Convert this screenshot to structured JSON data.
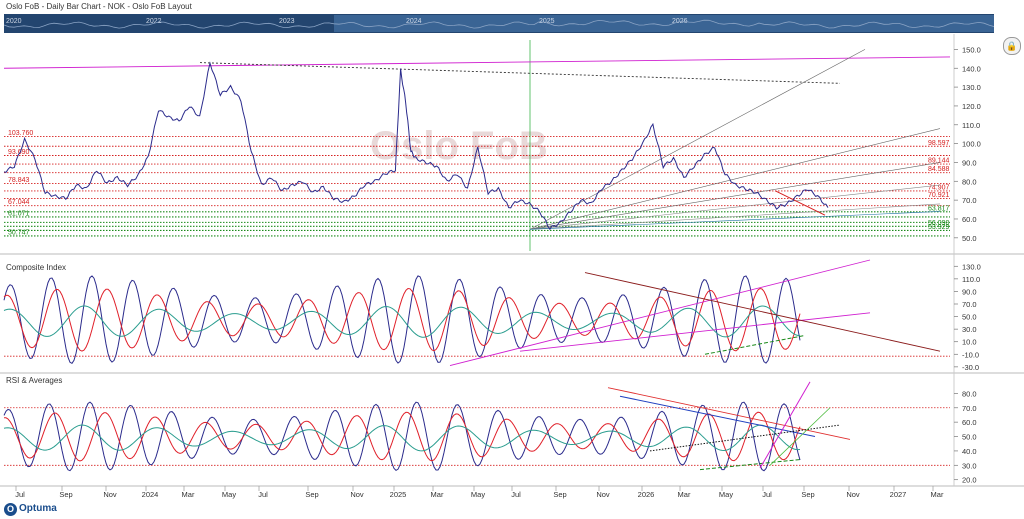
{
  "window": {
    "title": "Oslo FoB - Daily Bar Chart - NOK - Oslo FoB Layout"
  },
  "overview": {
    "years": [
      "2020",
      "2022",
      "2023",
      "2024",
      "2025",
      "2026"
    ]
  },
  "watermark": "Oslo FoB",
  "branding": {
    "logo": "Optuma"
  },
  "icons": {
    "lock": "lock-icon"
  },
  "colors": {
    "price": "#2b2b8c",
    "fast": "#e0202a",
    "slow": "#2a9d8f",
    "magenta": "#d020d0",
    "red_level": "#d62020",
    "green_level": "#1a8a1a"
  },
  "chart_data": [
    {
      "name": "price",
      "type": "line",
      "y_ticks": [
        150,
        140,
        130,
        120,
        110,
        100,
        90,
        80,
        70,
        60,
        50
      ],
      "ylim": [
        43,
        155
      ],
      "series_points": [
        [
          0,
          85
        ],
        [
          10,
          88
        ],
        [
          20,
          102
        ],
        [
          30,
          92
        ],
        [
          40,
          74
        ],
        [
          50,
          72
        ],
        [
          60,
          71
        ],
        [
          70,
          78
        ],
        [
          80,
          76
        ],
        [
          90,
          86
        ],
        [
          100,
          79
        ],
        [
          110,
          82
        ],
        [
          120,
          78
        ],
        [
          130,
          83
        ],
        [
          140,
          93
        ],
        [
          150,
          118
        ],
        [
          160,
          114
        ],
        [
          170,
          112
        ],
        [
          180,
          120
        ],
        [
          190,
          114
        ],
        [
          200,
          143
        ],
        [
          210,
          126
        ],
        [
          220,
          130
        ],
        [
          230,
          123
        ],
        [
          240,
          96
        ],
        [
          250,
          78
        ],
        [
          260,
          82
        ],
        [
          270,
          75
        ],
        [
          280,
          78
        ],
        [
          290,
          80
        ],
        [
          300,
          74
        ],
        [
          310,
          77
        ],
        [
          320,
          71
        ],
        [
          330,
          69
        ],
        [
          340,
          72
        ],
        [
          350,
          78
        ],
        [
          360,
          80
        ],
        [
          370,
          84
        ],
        [
          380,
          86
        ],
        [
          385,
          139
        ],
        [
          390,
          122
        ],
        [
          395,
          96
        ],
        [
          400,
          92
        ],
        [
          410,
          90
        ],
        [
          420,
          88
        ],
        [
          430,
          80
        ],
        [
          440,
          84
        ],
        [
          450,
          76
        ],
        [
          460,
          98
        ],
        [
          470,
          74
        ],
        [
          480,
          76
        ],
        [
          490,
          66
        ],
        [
          500,
          70
        ],
        [
          510,
          68
        ],
        [
          520,
          64
        ],
        [
          530,
          55
        ],
        [
          540,
          58
        ],
        [
          550,
          64
        ],
        [
          560,
          70
        ],
        [
          570,
          68
        ],
        [
          580,
          76
        ],
        [
          590,
          80
        ],
        [
          600,
          86
        ],
        [
          610,
          92
        ],
        [
          620,
          100
        ],
        [
          630,
          110
        ],
        [
          640,
          88
        ],
        [
          650,
          92
        ],
        [
          660,
          82
        ],
        [
          670,
          88
        ],
        [
          680,
          94
        ],
        [
          690,
          98
        ],
        [
          700,
          84
        ],
        [
          710,
          78
        ],
        [
          720,
          76
        ],
        [
          730,
          74
        ],
        [
          740,
          70
        ],
        [
          750,
          66
        ],
        [
          760,
          68
        ],
        [
          770,
          72
        ],
        [
          780,
          76
        ],
        [
          790,
          72
        ],
        [
          800,
          66
        ]
      ],
      "levels_red": [
        {
          "value": 103.76,
          "label": "103.760",
          "side": "left"
        },
        {
          "value": 98.597,
          "label": "98.597",
          "side": "right"
        },
        {
          "value": 93.69,
          "label": "93.690",
          "side": "left"
        },
        {
          "value": 89.144,
          "label": "89.144",
          "side": "right"
        },
        {
          "value": 84.588,
          "label": "84.588",
          "side": "right"
        },
        {
          "value": 78.843,
          "label": "78.843",
          "side": "left"
        },
        {
          "value": 74.907,
          "label": "74.907",
          "side": "right"
        },
        {
          "value": 70.921,
          "label": "70.921",
          "side": "right"
        },
        {
          "value": 67.044,
          "label": "67.044",
          "side": "left"
        }
      ],
      "levels_green": [
        {
          "value": 63.817,
          "label": "63.817",
          "side": "right"
        },
        {
          "value": 61.071,
          "label": "61.071",
          "side": "left"
        },
        {
          "value": 58.2,
          "label": "",
          "side": "right"
        },
        {
          "value": 56.09,
          "label": "56.090",
          "side": "right"
        },
        {
          "value": 53.929,
          "label": "53.929",
          "side": "right"
        },
        {
          "value": 51.0,
          "label": "50.747",
          "side": "left"
        }
      ]
    },
    {
      "name": "composite",
      "type": "line",
      "title": "Composite Index",
      "y_ticks": [
        130,
        110,
        90,
        70,
        50,
        30,
        10,
        -10,
        -30
      ],
      "ylim": [
        -35,
        140
      ]
    },
    {
      "name": "rsi",
      "type": "line",
      "title": "RSI & Averages",
      "y_ticks": [
        80,
        70,
        60,
        50,
        40,
        30,
        20
      ],
      "ylim": [
        17,
        90
      ]
    },
    {
      "name": "time_axis",
      "type": "axis",
      "x_labels": [
        "Jul",
        "Sep",
        "Nov",
        "2024",
        "Mar",
        "May",
        "Jul",
        "Sep",
        "Nov",
        "2025",
        "Mar",
        "May",
        "Jul",
        "Sep",
        "Nov",
        "2026",
        "Mar",
        "May",
        "Jul",
        "Sep",
        "Nov",
        "2027",
        "Mar"
      ]
    }
  ]
}
